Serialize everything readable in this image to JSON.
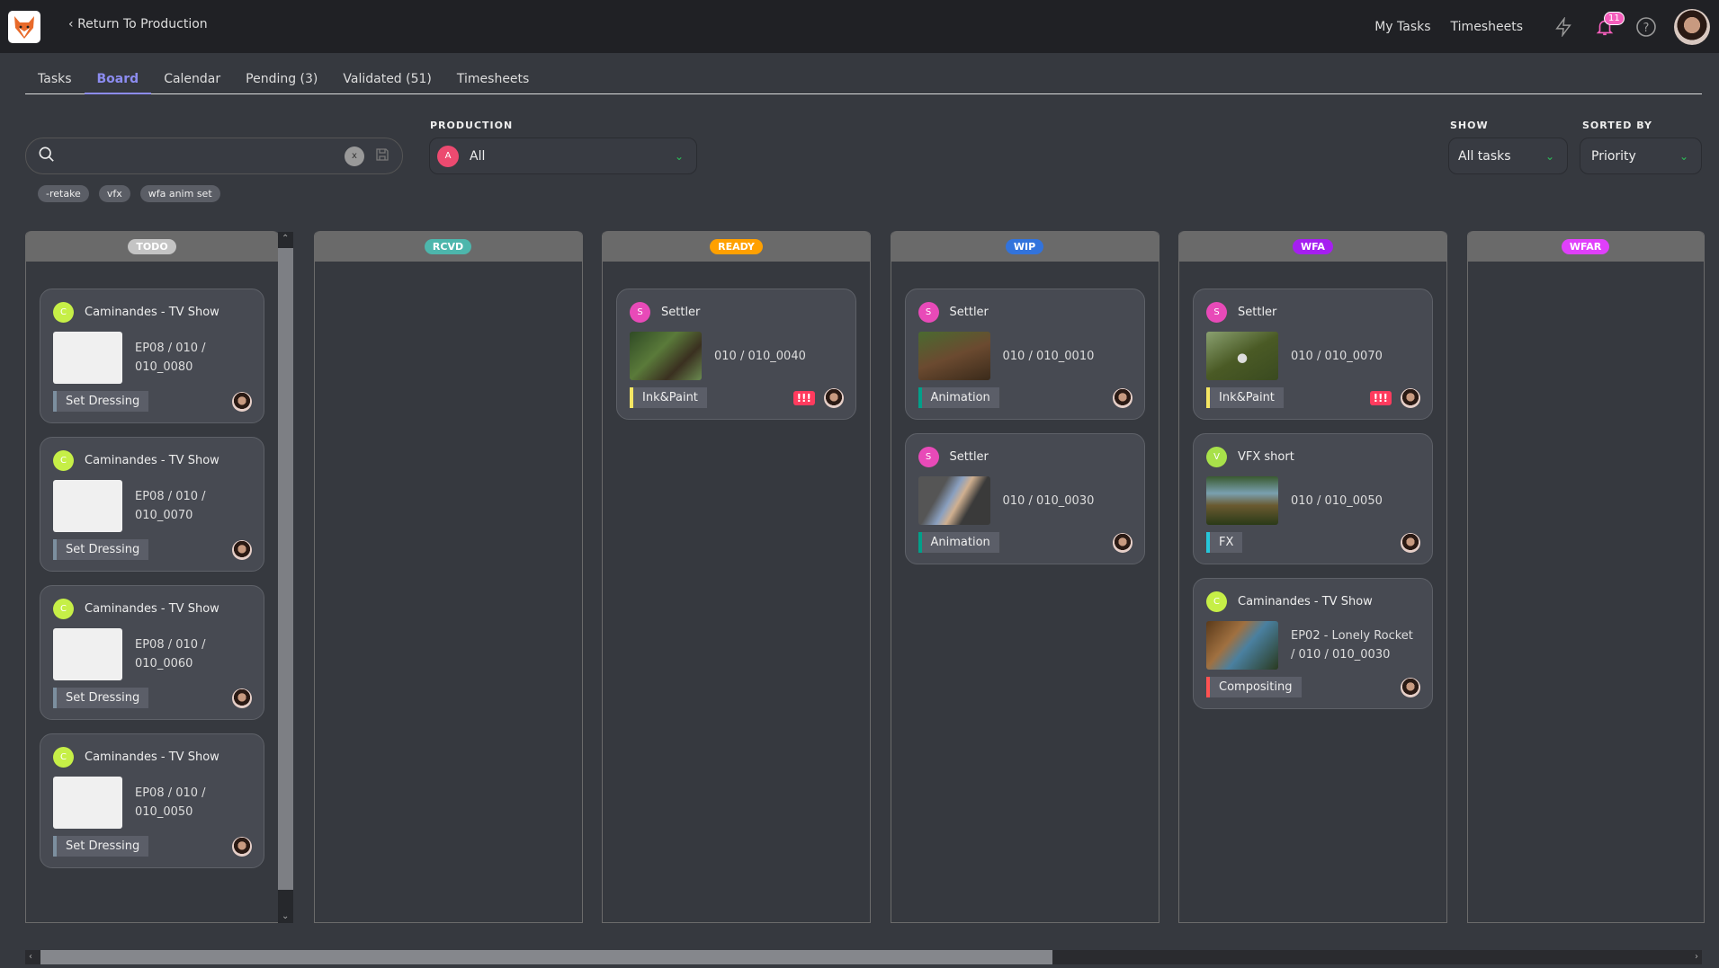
{
  "topbar": {
    "back_label": "Return To Production",
    "links": [
      "My Tasks",
      "Timesheets"
    ],
    "notification_count": "11"
  },
  "tabs": [
    {
      "label": "Tasks"
    },
    {
      "label": "Board",
      "active": true
    },
    {
      "label": "Calendar"
    },
    {
      "label": "Pending (3)"
    },
    {
      "label": "Validated (51)"
    },
    {
      "label": "Timesheets"
    }
  ],
  "filters": {
    "search_value": "",
    "clear_label": "x",
    "production_label": "PRODUCTION",
    "production_value": "All",
    "production_initial": "A",
    "show_label": "SHOW",
    "show_value": "All tasks",
    "sorted_label": "SORTED BY",
    "sorted_value": "Priority",
    "saved_searches": [
      "-retake",
      "vfx",
      "wfa anim set"
    ]
  },
  "columns": [
    {
      "status": "TODO",
      "color": "#c4c4c4",
      "cards": [
        {
          "production": "Caminandes - TV Show",
          "initial": "C",
          "pcolor": "#c6ef47",
          "entity": [
            "EP08 / 010 /",
            "010_0080"
          ],
          "preview": false,
          "task_type": "Set Dressing",
          "tcolor": "#7c8f9f",
          "priority": false
        },
        {
          "production": "Caminandes - TV Show",
          "initial": "C",
          "pcolor": "#c6ef47",
          "entity": [
            "EP08 / 010 /",
            "010_0070"
          ],
          "preview": false,
          "task_type": "Set Dressing",
          "tcolor": "#7c8f9f",
          "priority": false
        },
        {
          "production": "Caminandes - TV Show",
          "initial": "C",
          "pcolor": "#c6ef47",
          "entity": [
            "EP08 / 010 /",
            "010_0060"
          ],
          "preview": false,
          "task_type": "Set Dressing",
          "tcolor": "#7c8f9f",
          "priority": false
        },
        {
          "production": "Caminandes - TV Show",
          "initial": "C",
          "pcolor": "#c6ef47",
          "entity": [
            "EP08 / 010 /",
            "010_0050"
          ],
          "preview": false,
          "task_type": "Set Dressing",
          "tcolor": "#7c8f9f",
          "priority": false
        }
      ]
    },
    {
      "status": "RCVD",
      "color": "#4db6ac",
      "cards": []
    },
    {
      "status": "READY",
      "color": "#ffa000",
      "cards": [
        {
          "production": "Settler",
          "initial": "S",
          "pcolor": "#e84ab8",
          "entity": [
            "010 / 010_0040"
          ],
          "preview": true,
          "task_type": "Ink&Paint",
          "tcolor": "#f5e663",
          "priority": "!!!"
        }
      ]
    },
    {
      "status": "WIP",
      "color": "#3273dc",
      "cards": [
        {
          "production": "Settler",
          "initial": "S",
          "pcolor": "#e84ab8",
          "entity": [
            "010 / 010_0010"
          ],
          "preview": true,
          "task_type": "Animation",
          "tcolor": "#00a08a",
          "priority": false
        },
        {
          "production": "Settler",
          "initial": "S",
          "pcolor": "#e84ab8",
          "entity": [
            "010 / 010_0030"
          ],
          "preview": true,
          "task_type": "Animation",
          "tcolor": "#00a08a",
          "priority": false
        }
      ]
    },
    {
      "status": "WFA",
      "color": "#a51ff0",
      "cards": [
        {
          "production": "Settler",
          "initial": "S",
          "pcolor": "#e84ab8",
          "entity": [
            "010 / 010_0070"
          ],
          "preview": true,
          "task_type": "Ink&Paint",
          "tcolor": "#f5e663",
          "priority": "!!!"
        },
        {
          "production": "VFX short",
          "initial": "V",
          "pcolor": "#a8e14a",
          "entity": [
            "010 / 010_0050"
          ],
          "preview": true,
          "task_type": "FX",
          "tcolor": "#26c6da",
          "priority": false
        },
        {
          "production": "Caminandes - TV Show",
          "initial": "C",
          "pcolor": "#c6ef47",
          "entity": [
            "EP02 - Lonely Rocket",
            "/ 010 / 010_0030"
          ],
          "preview": true,
          "task_type": "Compositing",
          "tcolor": "#ff5252",
          "priority": false
        }
      ]
    },
    {
      "status": "WFAR",
      "color": "#e040fb",
      "cards": []
    }
  ]
}
